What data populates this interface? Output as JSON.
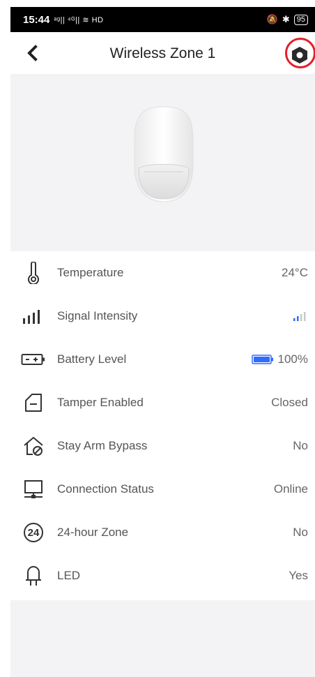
{
  "status_bar": {
    "time": "15:44",
    "network_text": "ᵃᵍ|| ⁴ᴳ|| ≋ HD",
    "right_text": "95"
  },
  "header": {
    "title": "Wireless Zone 1"
  },
  "rows": [
    {
      "label": "Temperature",
      "value": "24°C",
      "icon": "thermometer-icon"
    },
    {
      "label": "Signal Intensity",
      "value": "",
      "icon": "signal-bars-icon",
      "signal_level_fraction": 0.5
    },
    {
      "label": "Battery Level",
      "value": "100%",
      "icon": "battery-icon",
      "battery_fraction": 1.0
    },
    {
      "label": "Tamper Enabled",
      "value": "Closed",
      "icon": "tamper-icon"
    },
    {
      "label": "Stay Arm Bypass",
      "value": "No",
      "icon": "home-bypass-icon"
    },
    {
      "label": "Connection Status",
      "value": "Online",
      "icon": "monitor-network-icon"
    },
    {
      "label": "24-hour Zone",
      "value": "No",
      "icon": "24-hour-icon",
      "icon_text": "24"
    },
    {
      "label": "LED",
      "value": "Yes",
      "icon": "led-icon"
    }
  ],
  "colors": {
    "accent_blue": "#2f6bff",
    "highlight_red": "#e21f2a",
    "background": "#f3f3f5"
  }
}
